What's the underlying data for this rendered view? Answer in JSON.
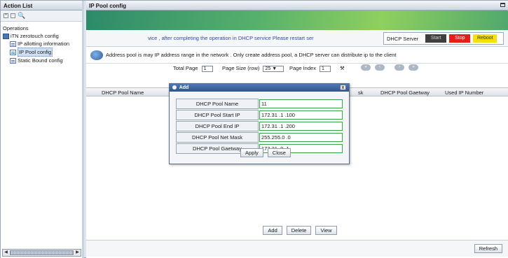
{
  "sidebar": {
    "title": "Action List",
    "section": "Operations",
    "root_item": "iTN zerotouch config",
    "items": [
      {
        "label": "IP allotting information"
      },
      {
        "label": "IP Pool config"
      },
      {
        "label": "Static Bound config"
      }
    ],
    "selected_index": 1
  },
  "main": {
    "title": "IP Pool config",
    "notice": "vice , after completing the operation in  DHCP service    Please restart ser",
    "dhcp_server_label": "DHCP Server",
    "start_label": "Start",
    "stop_label": "Stop",
    "reboot_label": "Reboot",
    "description": "Address pool is may IP address range in the network . Only create address pool, a DHCP server  can distribute ip to the client",
    "pager": {
      "total_page_label": "Total Page",
      "total_page_value": "1",
      "page_size_label": "Page Size (row)",
      "page_size_value": "25",
      "page_index_label": "Page Index",
      "page_index_value": "1"
    },
    "columns": {
      "name": "DHCP Pool Name",
      "mask": "sk",
      "gateway": "DHCP Pool Gaetway",
      "used": "Used IP Number"
    },
    "buttons": {
      "add": "Add",
      "delete": "Delete",
      "view": "View",
      "refresh": "Refresh"
    }
  },
  "modal": {
    "title": "Add",
    "close_glyph": "x",
    "fields": [
      {
        "label": "DHCP Pool Name",
        "value": "11"
      },
      {
        "label": "DHCP Pool Start IP",
        "value": "172.31 .1 .100"
      },
      {
        "label": "DHCP Pool End IP",
        "value": "172.31 .1 .200"
      },
      {
        "label": "DHCP Pool Net Mask",
        "value": "255.255.0 .0"
      },
      {
        "label": "DHCP Pool Gaetway",
        "value": "172.31 .0 .1"
      }
    ],
    "apply_label": "Apply",
    "close_label": "Close"
  },
  "colors": {
    "banner_green": "#55b06c",
    "stop_red": "#e81c1c",
    "reboot_yellow": "#f5e10a",
    "field_border_green": "#3aa34a",
    "notice_blue": "#2a4ea0"
  }
}
